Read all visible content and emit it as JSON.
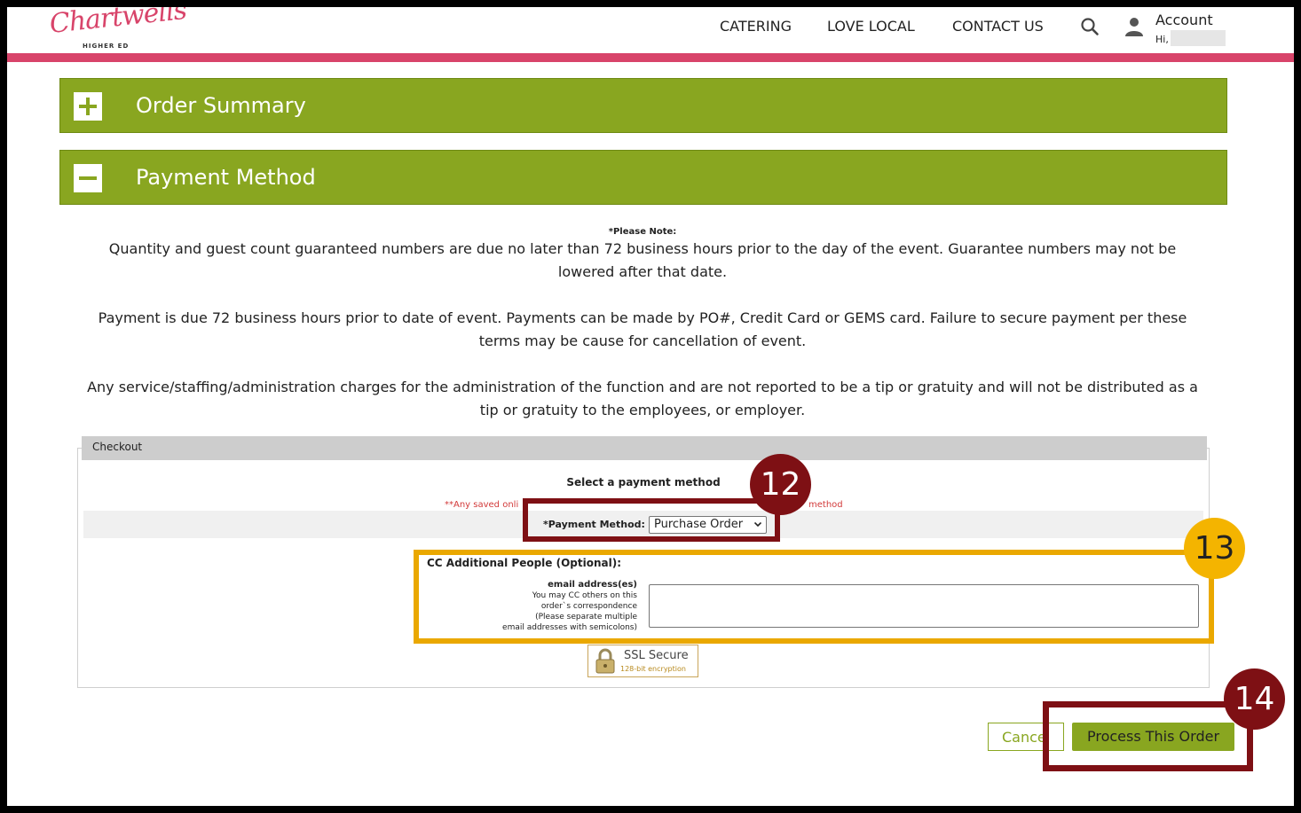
{
  "header": {
    "logo": {
      "text": "Chartwells",
      "sub": "HIGHER ED"
    },
    "nav": [
      "CATERING",
      "LOVE LOCAL",
      "CONTACT US"
    ],
    "account_label": "Account",
    "greeting": "Hi,"
  },
  "accordion": {
    "order_summary": "Order Summary",
    "payment_method": "Payment Method"
  },
  "note": {
    "heading": "*Please Note:",
    "paragraphs": [
      "Quantity and guest count guaranteed numbers are due no later than 72 business hours prior to the day of the event. Guarantee numbers may not be lowered after that date.",
      "Payment is due 72 business hours prior to date of event. Payments can be made by PO#, Credit Card or GEMS card. Failure to secure payment per these terms may be cause for cancellation of event.",
      "Any service/staffing/administration charges for the administration of the function and are not reported to be a tip or gratuity and will not be distributed as a tip or gratuity to the employees, or employer."
    ]
  },
  "checkout": {
    "title": "Checkout",
    "select_heading": "Select a payment method",
    "saved_note": "**Any saved onli",
    "saved_note_end": "method",
    "payment_method_label": "*Payment Method:",
    "payment_method_value": "Purchase Order",
    "cc_heading": "CC Additional People (Optional):",
    "email_label_bold": "email address(es)",
    "email_label_lines": [
      "You may CC others on this",
      "order`s correspondence",
      "(Please separate multiple",
      "email addresses with semicolons)"
    ],
    "email_value": "",
    "ssl_title": "SSL Secure",
    "ssl_sub": "128-bit encryption"
  },
  "buttons": {
    "cancel": "Cance",
    "process": "Process This Order"
  },
  "callouts": {
    "c12": "12",
    "c13": "13",
    "c14": "14"
  },
  "colors": {
    "brand_pink": "#d8446a",
    "panel_green": "#89a620",
    "callout_dark_red": "#7e1014",
    "callout_gold": "#f4b400"
  }
}
